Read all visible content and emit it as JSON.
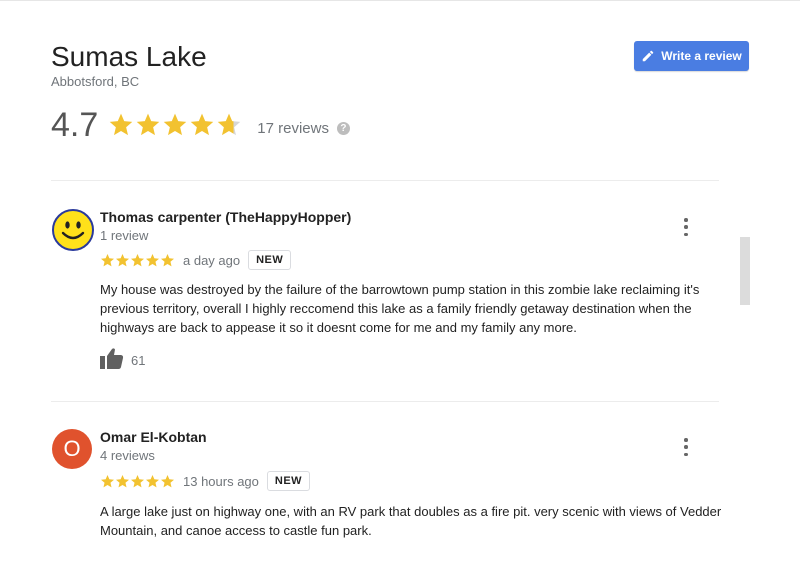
{
  "place": {
    "title": "Sumas Lake",
    "subtitle": "Abbotsford, BC",
    "write_review_label": "Write a review"
  },
  "rating": {
    "score": "4.7",
    "stars_value": 4.7,
    "stars_max": 5,
    "reviews_label": "17 reviews",
    "help_symbol": "?"
  },
  "colors": {
    "accent": "#4a7de2",
    "star": "#f2c230",
    "star_empty": "#d6d6d6",
    "avatar_letter_bg": "#e0522d",
    "smiley_yellow": "#ffe11a"
  },
  "reviews": [
    {
      "name": "Thomas carpenter (TheHappyHopper)",
      "sub": "1 review",
      "avatar_icon": "smiley-face-icon",
      "stars": 5,
      "time": "a day ago",
      "badge": "NEW",
      "text": "My house was destroyed by the failure of the barrowtown pump station in this zombie lake reclaiming it's previous territory, overall I highly reccomend this lake as a family friendly getaway destination when the highways are back to appease it so it doesnt come for me and my family any more.",
      "likes": "61"
    },
    {
      "name": "Omar El-Kobtan",
      "sub": "4 reviews",
      "avatar_letter": "O",
      "stars": 5,
      "time": "13 hours ago",
      "badge": "NEW",
      "text": "A large lake just on highway one, with an RV park that doubles as a fire pit. very scenic with views of Vedder Mountain, and canoe access to castle fun park."
    }
  ]
}
